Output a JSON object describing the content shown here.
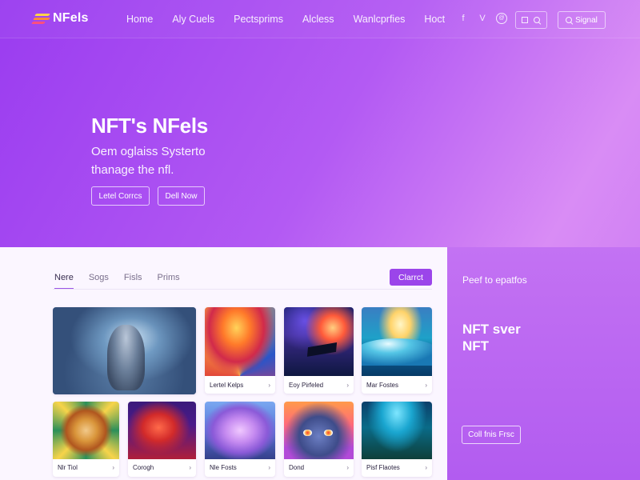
{
  "brand": {
    "name": "NFels"
  },
  "nav": {
    "links": [
      "Home",
      "Aly Cuels",
      "Pectsprims",
      "Alcless",
      "Wanlcprfies",
      "Hoct"
    ],
    "social": [
      "f",
      "V",
      "@"
    ],
    "signup_label": "Signal"
  },
  "hero": {
    "title": "NFT's NFels",
    "subtitle_line1": "Oem oglaiss Systerto",
    "subtitle_line2": "thanage the nfl.",
    "primary_button": "Letel Corrcs",
    "secondary_button": "Dell Now"
  },
  "gallery": {
    "tabs": [
      "Nere",
      "Sogs",
      "Fisls",
      "Prims"
    ],
    "active_tab": 0,
    "connect_label": "Clarrct",
    "cards": [
      {
        "caption": ""
      },
      {
        "caption": "Lertel Kelps"
      },
      {
        "caption": "Eoy Pirfeled"
      },
      {
        "caption": "Mar Fostes"
      },
      {
        "caption": "Nlr Tiol"
      },
      {
        "caption": "Corogh"
      },
      {
        "caption": "Nle Fosts"
      },
      {
        "caption": "Dond"
      },
      {
        "caption": "Pisf Flaotes"
      }
    ]
  },
  "side": {
    "top_text": "Peef to epatfos",
    "title_line1": "NFT sver",
    "title_line2": "NFT",
    "button_label": "Coll fnis Frsc"
  },
  "colors": {
    "accent": "#9b45ea",
    "panel_bg": "#fbf6ff",
    "side_bg": "#b25cf0"
  }
}
